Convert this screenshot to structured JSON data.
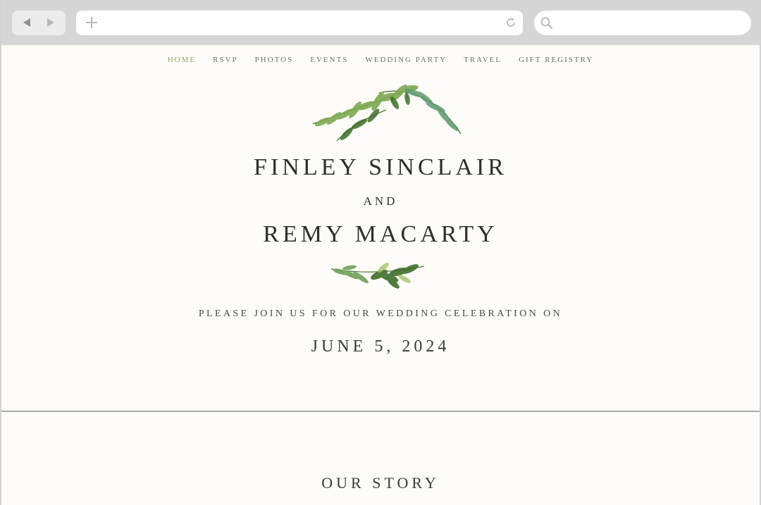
{
  "browser": {
    "back_icon": "back-arrow-icon",
    "forward_icon": "forward-arrow-icon",
    "new_tab_icon": "plus-icon",
    "reload_icon": "reload-icon",
    "search_icon": "search-icon",
    "url_value": "",
    "search_value": ""
  },
  "nav": {
    "items": [
      {
        "label": "HOME",
        "active": true
      },
      {
        "label": "RSVP"
      },
      {
        "label": "PHOTOS"
      },
      {
        "label": "EVENTS"
      },
      {
        "label": "WEDDING PARTY"
      },
      {
        "label": "TRAVEL"
      },
      {
        "label": "GIFT REGISTRY"
      }
    ]
  },
  "hero": {
    "name1": "FINLEY SINCLAIR",
    "and": "AND",
    "name2": "REMY MACARTY",
    "invite": "PLEASE JOIN US FOR OUR WEDDING CELEBRATION ON",
    "date": "JUNE 5, 2024"
  },
  "story": {
    "title": "OUR STORY"
  },
  "colors": {
    "accent": "#8ea366",
    "background": "#fdfcf8",
    "text": "#2f2f2f",
    "leaf_dark": "#3e6b2a",
    "leaf_light": "#8fb86a"
  }
}
